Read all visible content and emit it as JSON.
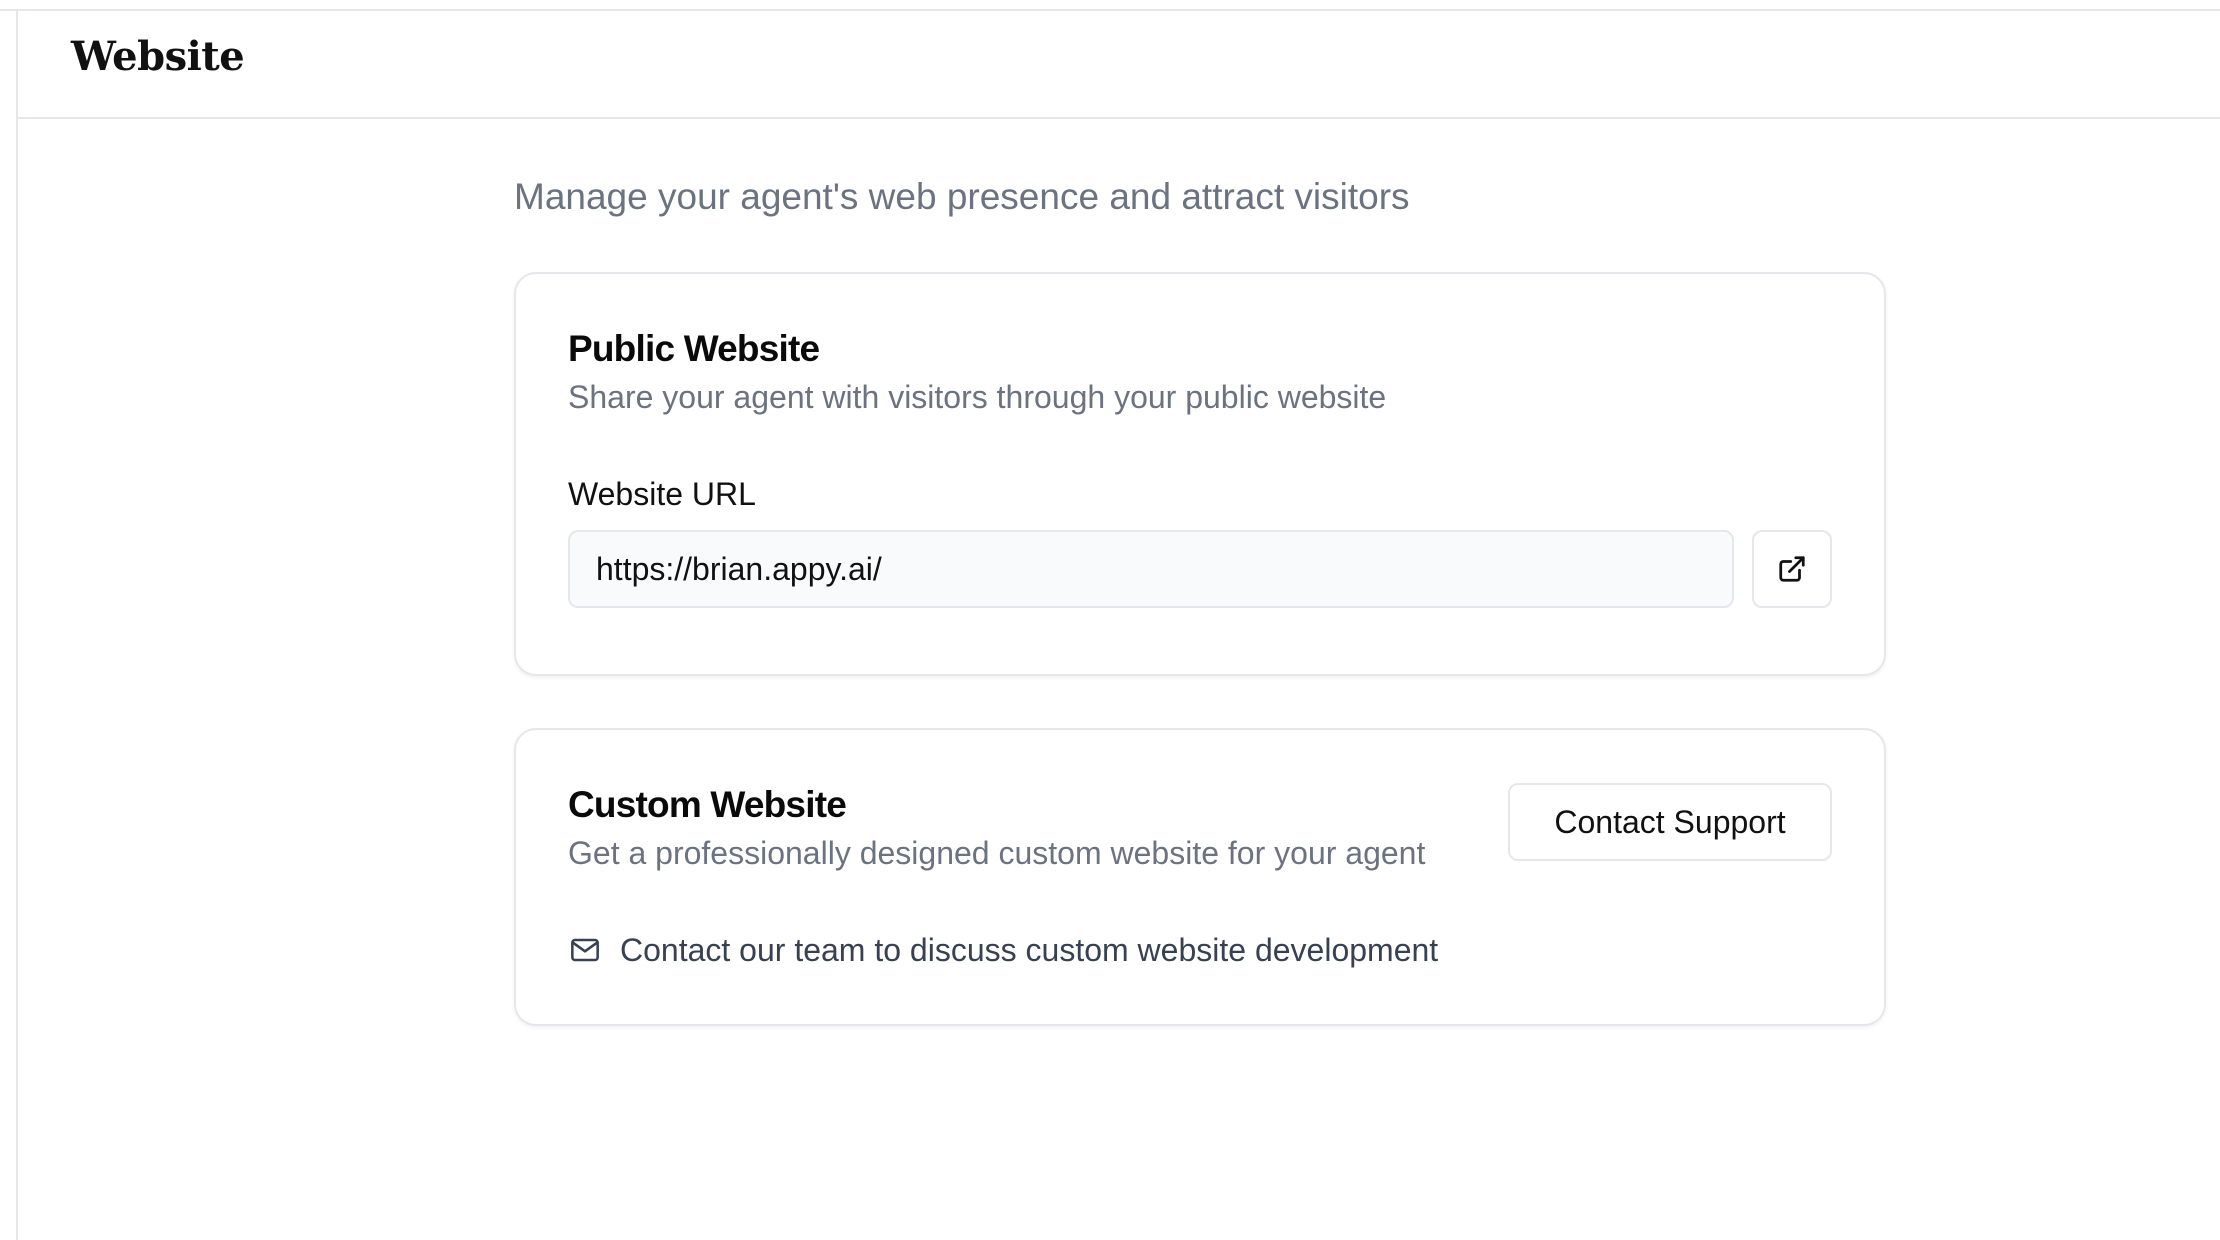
{
  "header": {
    "title": "Website"
  },
  "main": {
    "description": "Manage your agent's web presence and attract visitors"
  },
  "public_website": {
    "title": "Public Website",
    "subtitle": "Share your agent with visitors through your public website",
    "url_label": "Website URL",
    "url_value": "https://brian.appy.ai/",
    "open_icon": "external-link-icon"
  },
  "custom_website": {
    "title": "Custom Website",
    "subtitle": "Get a professionally designed custom website for your agent",
    "button_label": "Contact Support",
    "note": "Contact our team to discuss custom website development",
    "note_icon": "mail-icon"
  },
  "colors": {
    "border": "#e5e7eb",
    "muted_text": "#6b7280",
    "input_bg": "#f9fafb"
  }
}
